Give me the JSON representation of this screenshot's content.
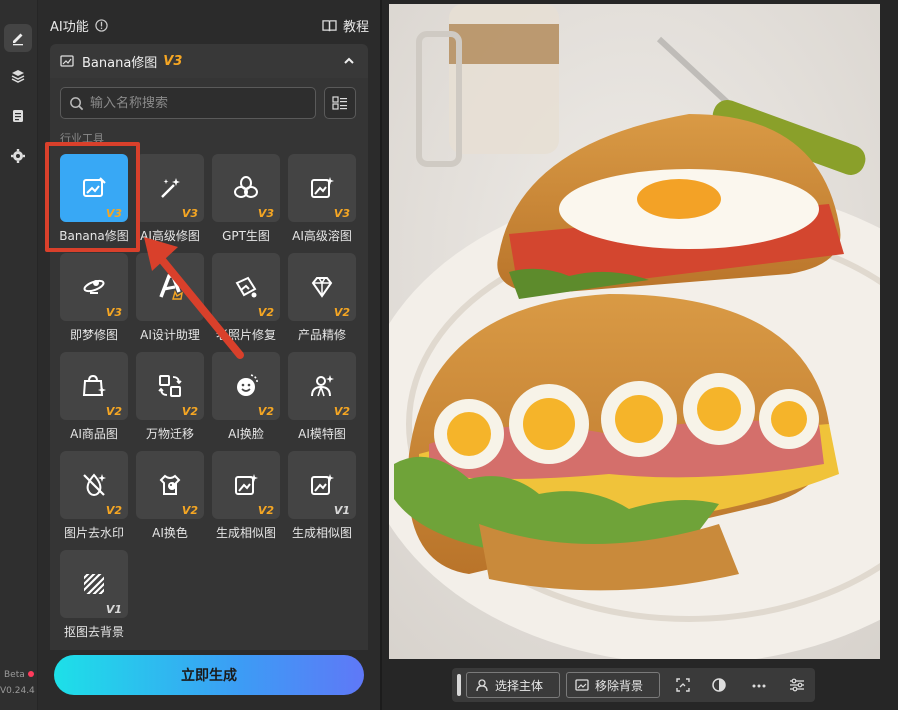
{
  "panel": {
    "title": "AI功能",
    "tutorial_label": "教程",
    "section": {
      "name": "Banana修图",
      "version": "V3"
    },
    "search_placeholder": "输入名称搜索",
    "category": "行业工具"
  },
  "tools": [
    {
      "label": "Banana修图",
      "version": "V3",
      "icon": "image-edit-icon",
      "selected": true
    },
    {
      "label": "AI高级修图",
      "version": "V3",
      "icon": "magic-wand-icon"
    },
    {
      "label": "GPT生图",
      "version": "V3",
      "icon": "gpt-knot-icon"
    },
    {
      "label": "AI高级溶图",
      "version": "V3",
      "icon": "image-sparkle-icon"
    },
    {
      "label": "即梦修图",
      "version": "V3",
      "icon": "dream-icon"
    },
    {
      "label": "AI设计助理",
      "version": "",
      "icon": "design-assistant-icon"
    },
    {
      "label": "老照片修复",
      "version": "V2",
      "icon": "photo-restore-icon"
    },
    {
      "label": "产品精修",
      "version": "V2",
      "icon": "diamond-icon"
    },
    {
      "label": "AI商品图",
      "version": "V2",
      "icon": "shopping-bag-icon"
    },
    {
      "label": "万物迁移",
      "version": "V2",
      "icon": "transfer-icon"
    },
    {
      "label": "AI换脸",
      "version": "V2",
      "icon": "face-swap-icon"
    },
    {
      "label": "AI模特图",
      "version": "V2",
      "icon": "model-icon"
    },
    {
      "label": "图片去水印",
      "version": "V2",
      "icon": "watermark-remove-icon"
    },
    {
      "label": "AI换色",
      "version": "V2",
      "icon": "recolor-icon"
    },
    {
      "label": "生成相似图",
      "version": "V2",
      "icon": "similar-image-icon"
    },
    {
      "label": "生成相似图",
      "version": "V1",
      "icon": "similar-image-icon"
    },
    {
      "label": "抠图去背景",
      "version": "V1",
      "icon": "cutout-icon"
    }
  ],
  "generate_label": "立即生成",
  "rail": {
    "beta": "Beta",
    "version": "V0.24.4"
  },
  "toolbar": {
    "select_subject": "选择主体",
    "remove_background": "移除背景"
  },
  "colors": {
    "accent_blue": "#38a8f5",
    "version_gold": "#f5a623",
    "highlight_red": "#d9402b"
  }
}
